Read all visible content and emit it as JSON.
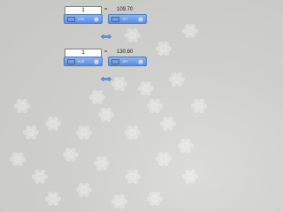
{
  "converters": [
    {
      "amount": "1",
      "equals": "=",
      "result": "109.70",
      "from": {
        "currency": "USD",
        "flag": "us-flag-icon"
      },
      "to": {
        "currency": "JPY",
        "flag": "jp-flag-icon"
      },
      "swap_icon": "swap-arrows-icon"
    },
    {
      "amount": "1",
      "equals": "=",
      "result": "130.60",
      "from": {
        "currency": "EUR",
        "flag": "eu-flag-icon"
      },
      "to": {
        "currency": "JPY",
        "flag": "jp-flag-icon"
      },
      "swap_icon": "swap-arrows-icon"
    }
  ],
  "colors": {
    "selector_blue": "#5c8ee0",
    "background": "#cfcfcc"
  }
}
